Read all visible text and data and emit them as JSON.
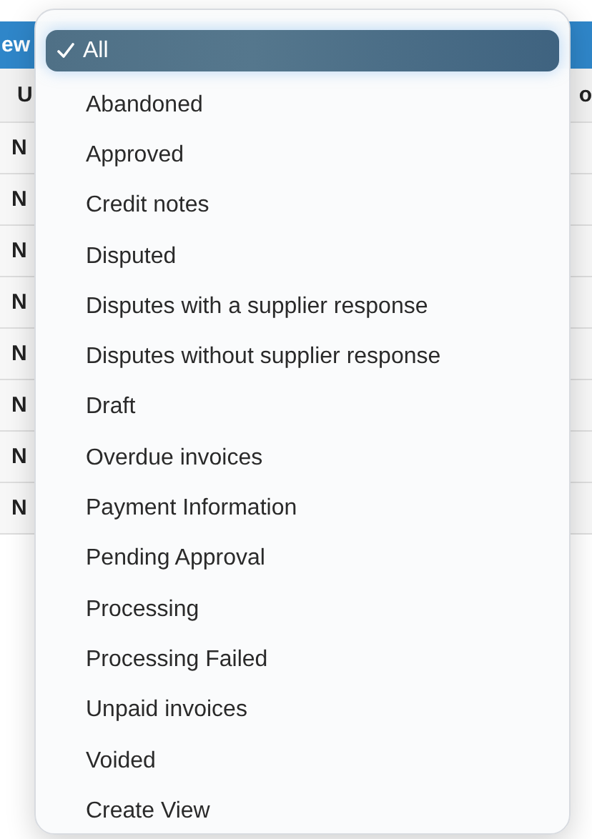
{
  "toolbar": {
    "title": "ew"
  },
  "table": {
    "columns": [
      "U",
      "o"
    ],
    "rows": [
      {
        "column_1": "N"
      },
      {
        "column_1": "N"
      },
      {
        "column_1": "N"
      },
      {
        "column_1": "N"
      },
      {
        "column_1": "N"
      },
      {
        "column_1": "N"
      },
      {
        "column_1": "N"
      },
      {
        "column_1": "N"
      }
    ]
  },
  "menu": {
    "items": [
      {
        "label": "All",
        "selected": true
      },
      {
        "label": "Abandoned",
        "selected": false
      },
      {
        "label": "Approved",
        "selected": false
      },
      {
        "label": "Credit notes",
        "selected": false
      },
      {
        "label": "Disputed",
        "selected": false
      },
      {
        "label": "Disputes with a supplier response",
        "selected": false
      },
      {
        "label": "Disputes without supplier response",
        "selected": false
      },
      {
        "label": "Draft",
        "selected": false
      },
      {
        "label": "Overdue invoices",
        "selected": false
      },
      {
        "label": "Payment Information",
        "selected": false
      },
      {
        "label": "Pending Approval",
        "selected": false
      },
      {
        "label": "Processing",
        "selected": false
      },
      {
        "label": "Processing Failed",
        "selected": false
      },
      {
        "label": "Unpaid invoices",
        "selected": false
      },
      {
        "label": "Voided",
        "selected": false
      },
      {
        "label": "Create View",
        "selected": false
      }
    ]
  }
}
